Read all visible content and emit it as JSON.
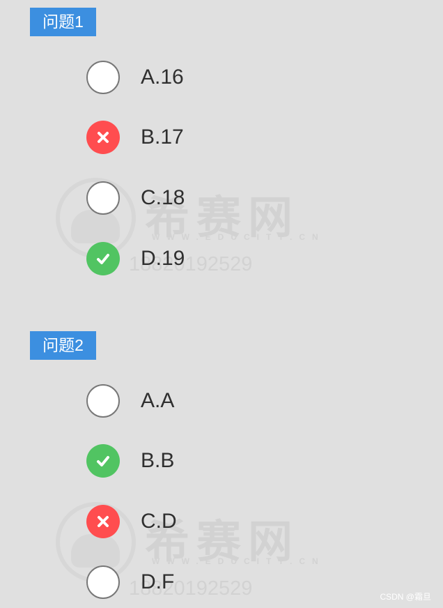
{
  "watermark": {
    "title": "希赛网",
    "url": "WWW.EDUCITY.CN",
    "phone": "18820192529"
  },
  "questions": [
    {
      "label": "问题1",
      "options": [
        {
          "text": "A.16",
          "state": "empty"
        },
        {
          "text": "B.17",
          "state": "wrong"
        },
        {
          "text": "C.18",
          "state": "empty"
        },
        {
          "text": "D.19",
          "state": "correct"
        }
      ]
    },
    {
      "label": "问题2",
      "options": [
        {
          "text": "A.A",
          "state": "empty"
        },
        {
          "text": "B.B",
          "state": "correct"
        },
        {
          "text": "C.D",
          "state": "wrong"
        },
        {
          "text": "D.F",
          "state": "empty"
        }
      ]
    }
  ],
  "credit": "CSDN @霜旦",
  "colors": {
    "background": "#e0e0e0",
    "tag": "#3c8fe0",
    "correct": "#51c462",
    "wrong": "#ff4d4f"
  }
}
